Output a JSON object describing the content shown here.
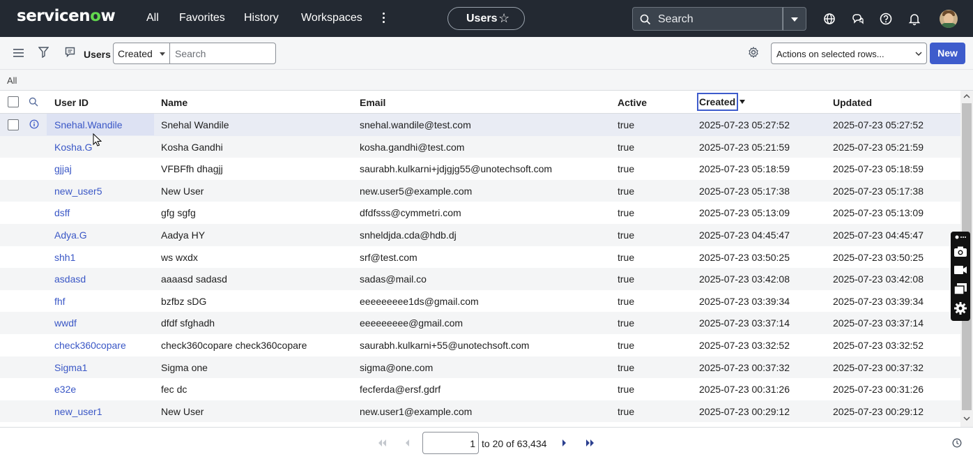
{
  "topnav": {
    "logo_pre": "servicen",
    "logo_o": "o",
    "logo_post": "w",
    "links": [
      "All",
      "Favorites",
      "History",
      "Workspaces"
    ],
    "context_label": "Users",
    "search_placeholder": "Search"
  },
  "toolbar": {
    "list_title": "Users",
    "field_select": "Created",
    "search_placeholder": "Search",
    "actions_select": "Actions on selected rows...",
    "new_label": "New"
  },
  "breadcrumb": "All",
  "table": {
    "columns": [
      "User ID",
      "Name",
      "Email",
      "Active",
      "Created",
      "Updated"
    ],
    "sort": {
      "column": "Created",
      "direction": "descending"
    },
    "rows": [
      {
        "user_id": "Snehal.Wandile",
        "name": "Snehal Wandile",
        "email": "snehal.wandile@test.com",
        "active": "true",
        "created": "2025-07-23 05:27:52",
        "updated": "2025-07-23 05:27:52"
      },
      {
        "user_id": "Kosha.G",
        "name": "Kosha Gandhi",
        "email": "kosha.gandhi@test.com",
        "active": "true",
        "created": "2025-07-23 05:21:59",
        "updated": "2025-07-23 05:21:59"
      },
      {
        "user_id": "gjjaj",
        "name": "VFBFfh dhagjj",
        "email": "saurabh.kulkarni+jdjgjg55@unotechsoft.com",
        "active": "true",
        "created": "2025-07-23 05:18:59",
        "updated": "2025-07-23 05:18:59"
      },
      {
        "user_id": "new_user5",
        "name": "New User",
        "email": "new.user5@example.com",
        "active": "true",
        "created": "2025-07-23 05:17:38",
        "updated": "2025-07-23 05:17:38"
      },
      {
        "user_id": "dsff",
        "name": "gfg sgfg",
        "email": "dfdfsss@cymmetri.com",
        "active": "true",
        "created": "2025-07-23 05:13:09",
        "updated": "2025-07-23 05:13:09"
      },
      {
        "user_id": "Adya.G",
        "name": "Aadya HY",
        "email": "snheldjda.cda@hdb.dj",
        "active": "true",
        "created": "2025-07-23 04:45:47",
        "updated": "2025-07-23 04:45:47"
      },
      {
        "user_id": "shh1",
        "name": "ws wxdx",
        "email": "srf@test.com",
        "active": "true",
        "created": "2025-07-23 03:50:25",
        "updated": "2025-07-23 03:50:25"
      },
      {
        "user_id": "asdasd",
        "name": "aaaasd sadasd",
        "email": "sadas@mail.co",
        "active": "true",
        "created": "2025-07-23 03:42:08",
        "updated": "2025-07-23 03:42:08"
      },
      {
        "user_id": "fhf",
        "name": "bzfbz sDG",
        "email": "eeeeeeeee1ds@gmail.com",
        "active": "true",
        "created": "2025-07-23 03:39:34",
        "updated": "2025-07-23 03:39:34"
      },
      {
        "user_id": "wwdf",
        "name": "dfdf sfghadh",
        "email": "eeeeeeeee@gmail.com",
        "active": "true",
        "created": "2025-07-23 03:37:14",
        "updated": "2025-07-23 03:37:14"
      },
      {
        "user_id": "check360copare",
        "name": "check360copare check360copare",
        "email": "saurabh.kulkarni+55@unotechsoft.com",
        "active": "true",
        "created": "2025-07-23 03:32:52",
        "updated": "2025-07-23 03:32:52"
      },
      {
        "user_id": "Sigma1",
        "name": "Sigma one",
        "email": "sigma@one.com",
        "active": "true",
        "created": "2025-07-23 00:37:32",
        "updated": "2025-07-23 00:37:32"
      },
      {
        "user_id": "e32e",
        "name": "fec dc",
        "email": "fecferda@ersf.gdrf",
        "active": "true",
        "created": "2025-07-23 00:31:26",
        "updated": "2025-07-23 00:31:26"
      },
      {
        "user_id": "new_user1",
        "name": "New User",
        "email": "new.user1@example.com",
        "active": "true",
        "created": "2025-07-23 00:29:12",
        "updated": "2025-07-23 00:29:12"
      }
    ]
  },
  "pagination": {
    "current": "1",
    "range_text": "to 20 of 63,434"
  },
  "colors": {
    "nav_bg": "#232932",
    "accent": "#3e5ccc",
    "link": "#3a57c6",
    "logo_o": "#62d84e"
  },
  "icons": [
    "search-icon",
    "star-icon",
    "globe-icon",
    "chat-icon",
    "help-icon",
    "bell-icon",
    "menu-icon",
    "filter-icon",
    "comment-icon",
    "gear-icon",
    "info-icon",
    "camera-icon",
    "video-icon",
    "copy-icon",
    "settings-icon",
    "clock-icon"
  ]
}
